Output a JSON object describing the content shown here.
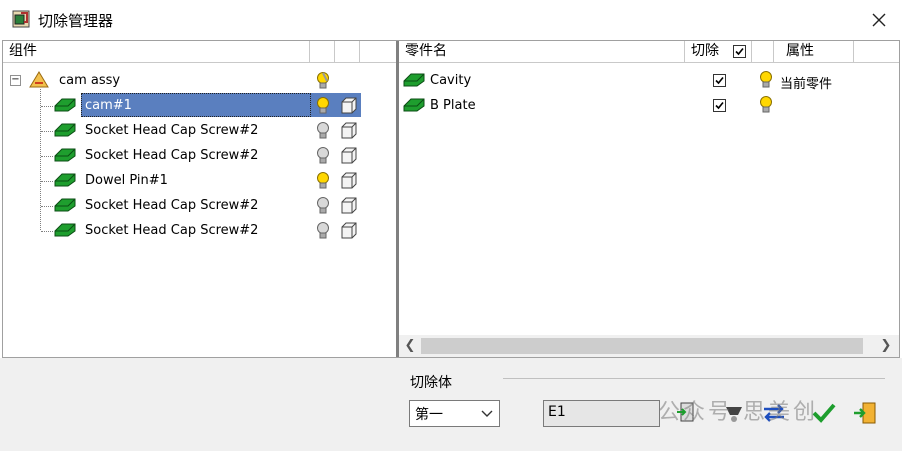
{
  "window": {
    "title": "切除管理器"
  },
  "tree": {
    "header": "组件",
    "root": {
      "label": "cam assy",
      "expander": "−"
    },
    "items": [
      {
        "label": "cam#1",
        "selected": true,
        "bulb": "lit"
      },
      {
        "label": "Socket Head Cap Screw#2",
        "bulb": "off"
      },
      {
        "label": "Socket Head Cap Screw#2",
        "bulb": "off"
      },
      {
        "label": "Dowel Pin#1",
        "bulb": "lit"
      },
      {
        "label": "Socket Head Cap Screw#2",
        "bulb": "off"
      },
      {
        "label": "Socket Head Cap Screw#2",
        "bulb": "off"
      }
    ]
  },
  "parts": {
    "headers": {
      "name": "零件名",
      "cut": "切除",
      "attr": "属性"
    },
    "rows": [
      {
        "name": "Cavity",
        "cut": true,
        "attr": "当前零件"
      },
      {
        "name": "B Plate",
        "cut": true,
        "attr": ""
      }
    ]
  },
  "bottom": {
    "group_label": "切除体",
    "combo_value": "第一",
    "text_value": "E1",
    "watermark": "公众号 思美创"
  },
  "colors": {
    "selection": "#5a7fbf",
    "bulb_lit": "#ffd700",
    "part_green": "#1e9e2e"
  }
}
